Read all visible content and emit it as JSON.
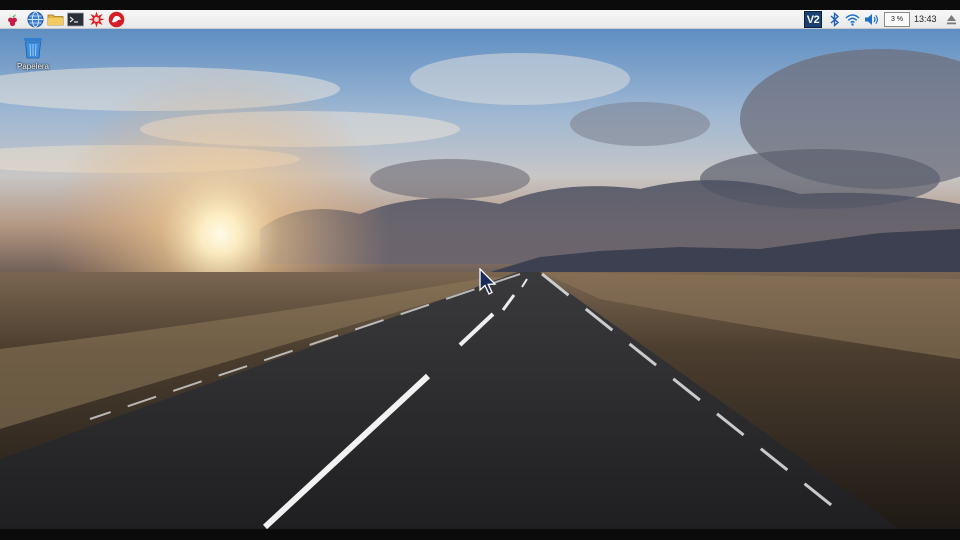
{
  "taskbar": {
    "launchers": [
      {
        "icon": "raspberry-menu-icon"
      },
      {
        "icon": "web-browser-globe-icon"
      },
      {
        "icon": "file-manager-folder-icon"
      },
      {
        "icon": "terminal-icon"
      },
      {
        "icon": "math-kernel-star-icon"
      },
      {
        "icon": "wolfram-icon"
      }
    ],
    "tray": {
      "vnc_label": "V2",
      "bluetooth": "bluetooth-icon",
      "wifi": "wifi-icon",
      "volume": "volume-icon",
      "cpu_usage": "3 %",
      "clock": "13:43",
      "eject": "eject-icon"
    }
  },
  "desktop": {
    "icons": [
      {
        "label": "Papelera",
        "icon": "trash-icon"
      }
    ],
    "wallpaper": "empty-road-sunset"
  },
  "colors": {
    "taskbar_bg": "#efefef",
    "vnc_bg": "#1b3f6e",
    "sky_top": "#5f8bbd",
    "sun": "#fff6d6",
    "road": "#2a2a2c"
  }
}
